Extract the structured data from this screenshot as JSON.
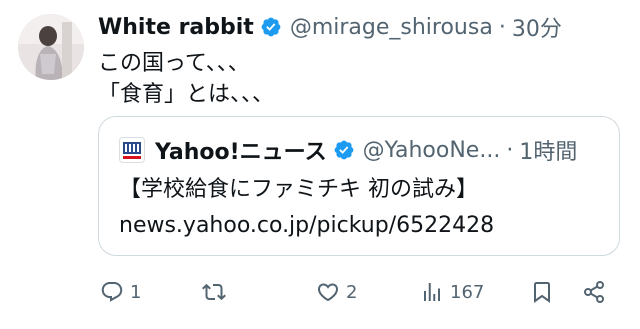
{
  "author": {
    "display_name": "White rabbit",
    "handle": "@mirage_shirousa",
    "separator": "·",
    "time": "30分",
    "verified_icon": "verified-badge-icon",
    "avatar_icon": "avatar"
  },
  "post": {
    "lines": [
      "この国って、、、",
      "「食育」とは、、、"
    ]
  },
  "quote": {
    "logo_icon": "yahoo-news-logo-icon",
    "display_name": "Yahoo!ニュース",
    "handle": "@YahooNe...",
    "separator": "·",
    "time": "1時間",
    "title": "【学校給食にファミチキ 初の試み】",
    "url": "news.yahoo.co.jp/pickup/6522428"
  },
  "actions": {
    "reply": {
      "icon": "reply-icon",
      "count": "1"
    },
    "repost": {
      "icon": "repost-icon",
      "count": ""
    },
    "like": {
      "icon": "heart-icon",
      "count": "2"
    },
    "views": {
      "icon": "views-icon",
      "count": "167"
    },
    "bookmark": {
      "icon": "bookmark-icon"
    },
    "share": {
      "icon": "share-icon"
    }
  },
  "colors": {
    "text_primary": "#0f1419",
    "text_secondary": "#536471",
    "verified_blue": "#1d9bf0",
    "border": "#cfd9de"
  }
}
